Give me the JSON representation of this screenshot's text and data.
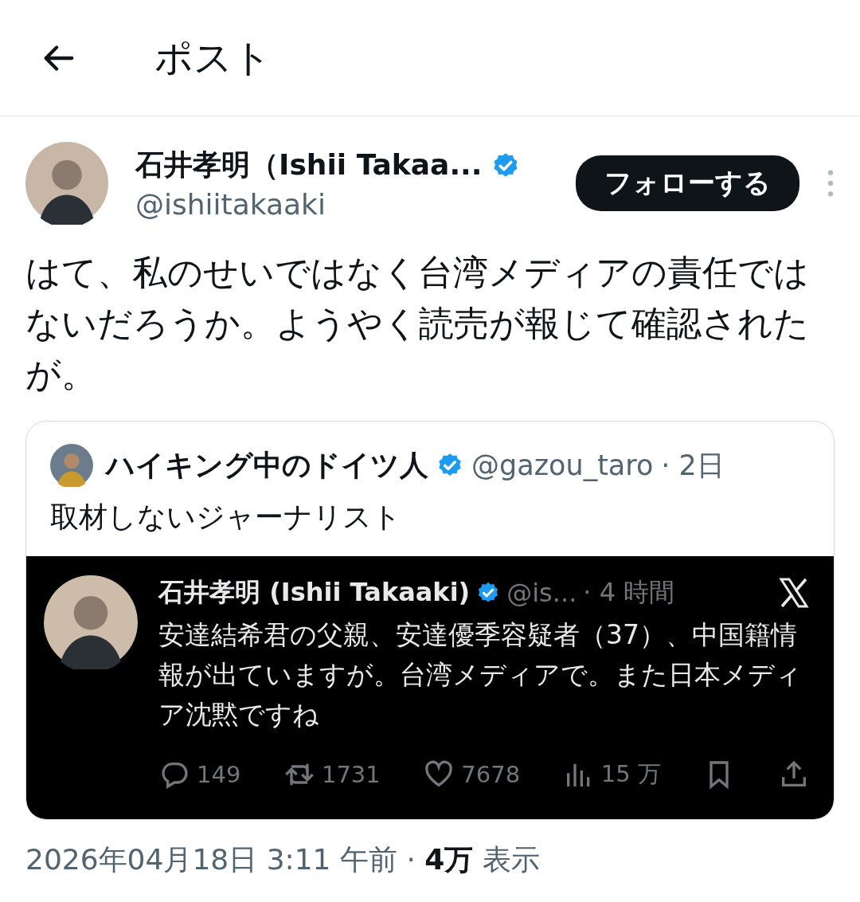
{
  "header": {
    "title": "ポスト"
  },
  "post": {
    "author": {
      "name": "石井孝明（Ishii Takaa...",
      "verified": true,
      "handle": "@ishiitakaaki"
    },
    "follow_button": "フォローする",
    "text": "はて、私のせいではなく台湾メディアの責任ではないだろうか。ようやく読売が報じて確認されたが。",
    "quote": {
      "author": {
        "name": "ハイキング中のドイツ人",
        "verified": true,
        "handle": "@gazou_taro",
        "time": "· 2日"
      },
      "text": "取材しないジャーナリスト",
      "embedded": {
        "name": "石井孝明 (Ishii Takaaki)",
        "verified": true,
        "handle": "@is...",
        "time": "· 4 時間",
        "text": "安達結希君の父親、安達優季容疑者（37）、中国籍情報が出ていますが。台湾メディアで。また日本メディア沈黙ですね",
        "stats": [
          {
            "kind": "reply",
            "count": "149"
          },
          {
            "kind": "repost",
            "count": "1731"
          },
          {
            "kind": "like",
            "count": "7678"
          },
          {
            "kind": "views",
            "count": "15 万"
          },
          {
            "kind": "bookmark"
          },
          {
            "kind": "share"
          }
        ]
      }
    },
    "meta": "2026年04月18日 3:11 午前 · **4万** 表示"
  }
}
